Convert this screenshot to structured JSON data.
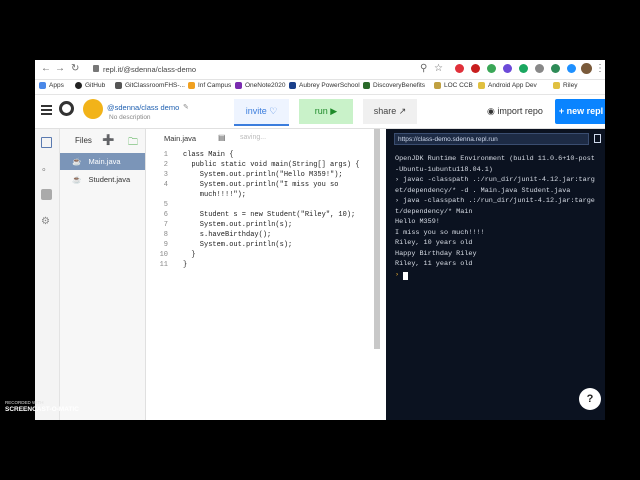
{
  "browser": {
    "url": "repl.it/@sdenna/class-demo",
    "bookmarks": [
      "Apps",
      "GitHub",
      "GitClassroomFHS-...",
      "Inf Campus",
      "OneNote2020",
      "Aubrey PowerSchool",
      "DiscoveryBenefits",
      "LOC CCB",
      "Android App Dev",
      "Riley"
    ]
  },
  "header": {
    "user_repl": "@sdenna/class demo",
    "description": "No description",
    "invite_label": "invite",
    "run_label": "run",
    "share_label": "share",
    "import_label": "import repo",
    "new_label": "+ new repl"
  },
  "files": {
    "title": "Files",
    "items": [
      "Main.java",
      "Student.java"
    ]
  },
  "editor": {
    "tab": "Main.java",
    "status": "saving...",
    "lines": [
      {
        "n": "1",
        "t": "class Main {"
      },
      {
        "n": "2",
        "t": "  public static void main(String[] args) {"
      },
      {
        "n": "3",
        "t": "    System.out.println(\"Hello M359!\");"
      },
      {
        "n": "4",
        "t": "    System.out.println(\"I miss you so"
      },
      {
        "n": "",
        "t": "    much!!!!\");"
      },
      {
        "n": "5",
        "t": ""
      },
      {
        "n": "6",
        "t": "    Student s = new Student(\"Riley\", 10);"
      },
      {
        "n": "7",
        "t": "    System.out.println(s);"
      },
      {
        "n": "8",
        "t": "    s.haveBirthday();"
      },
      {
        "n": "9",
        "t": "    System.out.println(s);"
      },
      {
        "n": "10",
        "t": "  }"
      },
      {
        "n": "11",
        "t": "}"
      }
    ]
  },
  "console": {
    "url": "https://class-demo.sdenna.repl.run",
    "lines": [
      "OpenJDK Runtime Environment (build 11.0.6+10-post",
      "-Ubuntu-1ubuntu118.04.1)",
      "› javac -classpath .:/run_dir/junit-4.12.jar:targ",
      "et/dependency/* -d . Main.java Student.java",
      "› java -classpath .:/run_dir/junit-4.12.jar:targe",
      "t/dependency/* Main",
      "Hello M359!",
      "I miss you so much!!!!",
      "Riley, 10 years old",
      "Happy Birthday Riley",
      "Riley, 11 years old"
    ],
    "prompt": "›"
  },
  "help_label": "?",
  "watermark": {
    "top": "RECORDED WITH",
    "brand": "SCREENCAST-O-MATIC"
  },
  "colors": {
    "accent": "#0a84ff",
    "run_bg": "#c9f2c9",
    "console_bg": "#0b1220"
  }
}
